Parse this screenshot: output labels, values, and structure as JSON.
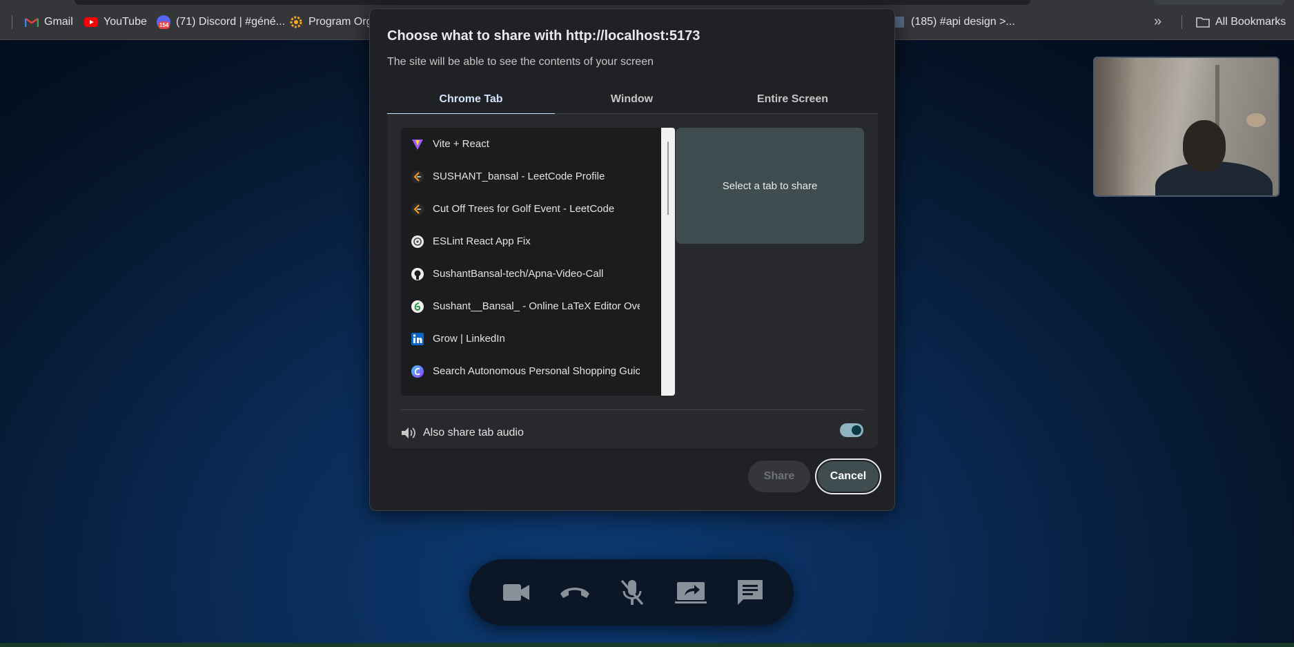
{
  "bookmarks": [
    {
      "label": "Gmail",
      "icon": "gmail-icon"
    },
    {
      "label": "YouTube",
      "icon": "youtube-icon"
    },
    {
      "label": "(71) Discord | #géné...",
      "icon": "discord-icon",
      "badge": "154"
    },
    {
      "label": "Program Org",
      "icon": "gear-icon"
    },
    {
      "label": "(185) #api design >...",
      "icon": "generic-site-icon"
    },
    {
      "label": "All Bookmarks",
      "icon": "folder-icon"
    }
  ],
  "dialog": {
    "title": "Choose what to share with http://localhost:5173",
    "subtitle": "The site will be able to see the contents of your screen",
    "tabs": [
      {
        "label": "Chrome Tab",
        "active": true
      },
      {
        "label": "Window",
        "active": false
      },
      {
        "label": "Entire Screen",
        "active": false
      }
    ],
    "tab_list": [
      {
        "label": "Vite + React",
        "icon": "vite-icon"
      },
      {
        "label": "SUSHANT_bansal - LeetCode Profile",
        "icon": "leetcode-icon"
      },
      {
        "label": "Cut Off Trees for Golf Event - LeetCode",
        "icon": "leetcode-icon"
      },
      {
        "label": "ESLint React App Fix",
        "icon": "openai-icon"
      },
      {
        "label": "SushantBansal-tech/Apna-Video-Call",
        "icon": "github-icon"
      },
      {
        "label": "Sushant__Bansal_ - Online LaTeX Editor Over",
        "icon": "overleaf-icon"
      },
      {
        "label": "Grow | LinkedIn",
        "icon": "linkedin-icon"
      },
      {
        "label": "Search Autonomous Personal Shopping Guic",
        "icon": "copilot-icon"
      }
    ],
    "preview_text": "Select a tab to share",
    "audio_label": "Also share tab audio",
    "audio_enabled": true,
    "share_label": "Share",
    "cancel_label": "Cancel"
  },
  "call_controls": [
    {
      "name": "camera-button",
      "icon": "video-camera-icon"
    },
    {
      "name": "end-call-button",
      "icon": "phone-hangup-icon"
    },
    {
      "name": "mic-button",
      "icon": "mic-off-icon"
    },
    {
      "name": "screen-share-button",
      "icon": "screen-share-icon"
    },
    {
      "name": "chat-button",
      "icon": "chat-icon"
    }
  ],
  "colors": {
    "toolbar": "#35363a",
    "dialog_bg": "#202124",
    "accent": "#c2e7ff",
    "preview_bg": "#3f4d50",
    "controls_icon": "#8a9099"
  }
}
